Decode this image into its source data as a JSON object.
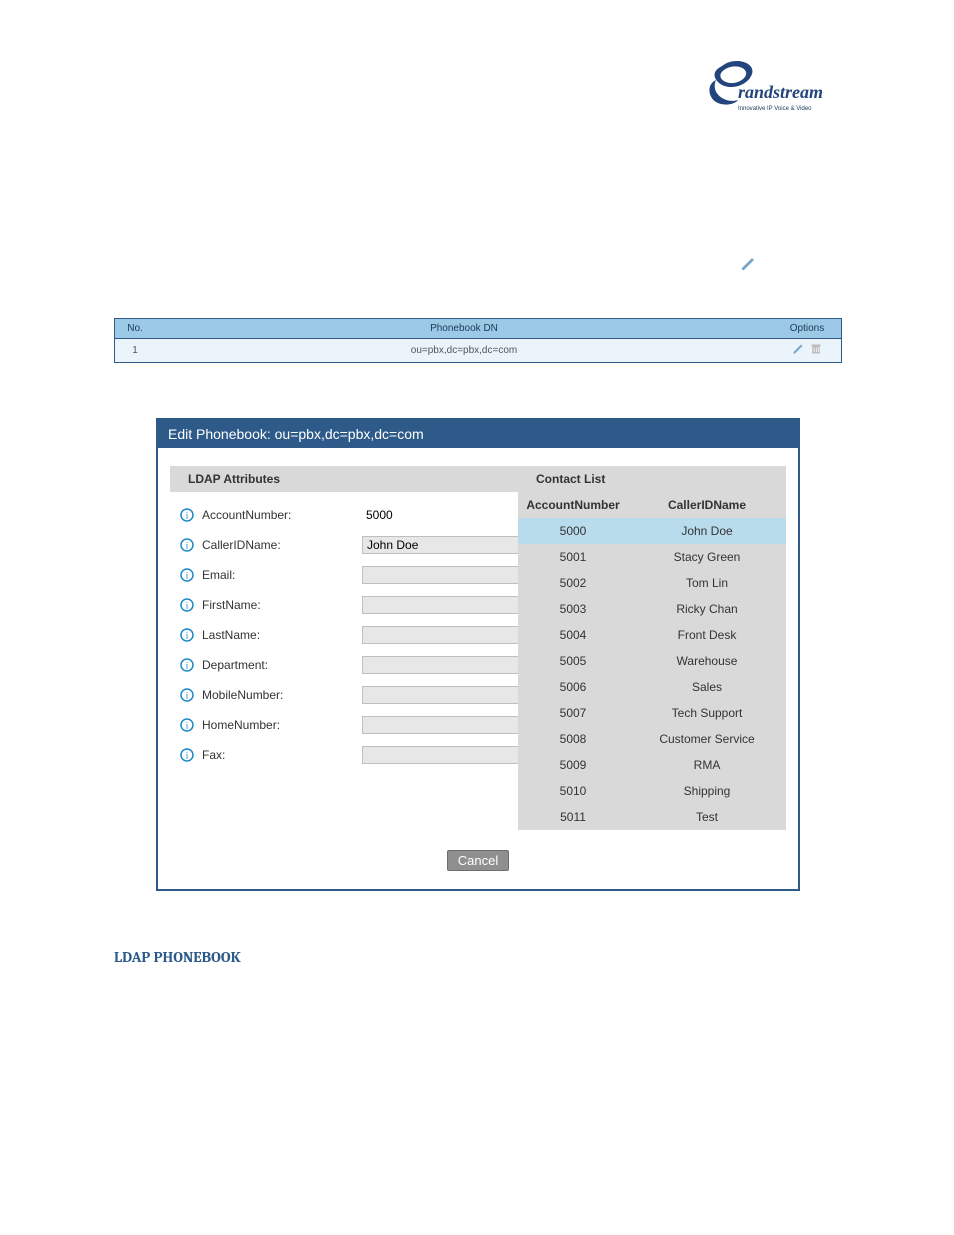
{
  "brand": {
    "name": "Grandstream",
    "tagline": "Innovative IP Voice & Video",
    "logo_color": "#23447c",
    "tagline_color": "#1a3a57"
  },
  "phonebook_table": {
    "headers": {
      "no": "No.",
      "dn": "Phonebook DN",
      "options": "Options"
    },
    "rows": [
      {
        "no": "1",
        "dn": "ou=pbx,dc=pbx,dc=com"
      }
    ]
  },
  "dialog": {
    "title": "Edit Phonebook: ou=pbx,dc=pbx,dc=com",
    "ldap_header": "LDAP Attributes",
    "contact_header": "Contact List",
    "attributes": {
      "accountNumber": {
        "label": "AccountNumber:",
        "value": "5000",
        "readonly": true
      },
      "callerIDName": {
        "label": "CallerIDName:",
        "value": "John Doe",
        "readonly": false
      },
      "email": {
        "label": "Email:",
        "value": "",
        "readonly": false
      },
      "firstName": {
        "label": "FirstName:",
        "value": "",
        "readonly": false
      },
      "lastName": {
        "label": "LastName:",
        "value": "",
        "readonly": false
      },
      "department": {
        "label": "Department:",
        "value": "",
        "readonly": false
      },
      "mobileNumber": {
        "label": "MobileNumber:",
        "value": "",
        "readonly": false
      },
      "homeNumber": {
        "label": "HomeNumber:",
        "value": "",
        "readonly": false
      },
      "fax": {
        "label": "Fax:",
        "value": "",
        "readonly": false
      }
    },
    "contact_columns": {
      "account": "AccountNumber",
      "name": "CallerIDName"
    },
    "contacts": [
      {
        "account": "5000",
        "name": "John Doe",
        "selected": true
      },
      {
        "account": "5001",
        "name": "Stacy Green"
      },
      {
        "account": "5002",
        "name": "Tom Lin"
      },
      {
        "account": "5003",
        "name": "Ricky Chan"
      },
      {
        "account": "5004",
        "name": "Front Desk"
      },
      {
        "account": "5005",
        "name": "Warehouse"
      },
      {
        "account": "5006",
        "name": "Sales"
      },
      {
        "account": "5007",
        "name": "Tech Support"
      },
      {
        "account": "5008",
        "name": "Customer Service"
      },
      {
        "account": "5009",
        "name": "RMA"
      },
      {
        "account": "5010",
        "name": "Shipping"
      },
      {
        "account": "5011",
        "name": "Test"
      }
    ],
    "buttons": {
      "cancel": "Cancel"
    }
  },
  "section_heading": "LDAP PHONEBOOK"
}
